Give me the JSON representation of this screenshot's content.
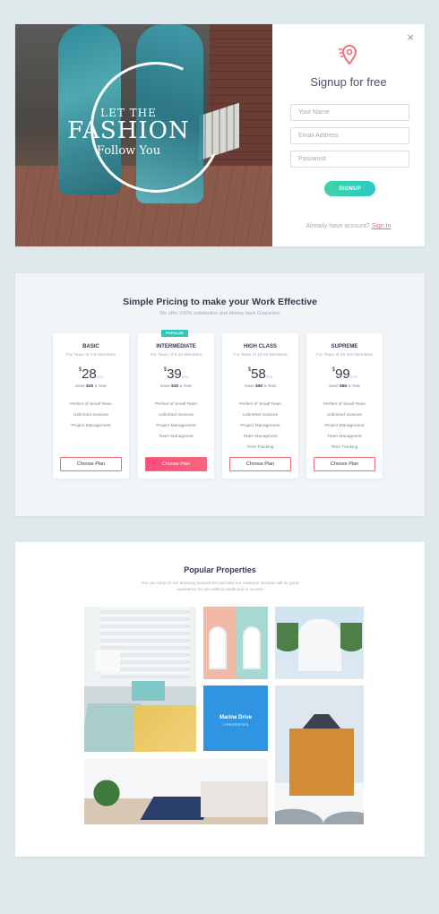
{
  "signup": {
    "hero": {
      "line1": "LET THE",
      "line2": "FASHION",
      "line3": "Follow You"
    },
    "title": "Signup for free",
    "name_placeholder": "Your Name",
    "email_placeholder": "Email Address",
    "password_placeholder": "Password",
    "button": "SIGNUP",
    "already_text": "Already have account?",
    "signin_link": "Sign In",
    "close": "×",
    "accent_color": "#f36b7a"
  },
  "pricing": {
    "title": "Simple Pricing to make your Work Effective",
    "subtitle": "We offer 100% satisfaction and Money back Guarantee",
    "popular_badge": "POPULAR",
    "plans": [
      {
        "name": "BASIC",
        "for": "For Team of 2-5 Members",
        "currency": "$",
        "price": "28",
        "per": "/mo",
        "save_prefix": "Save",
        "save": "$20",
        "save_suffix": "a Year",
        "features": [
          "Perfect of Small Team",
          "Unlimited Invoices",
          "Project Management"
        ],
        "button": "Choose Plan"
      },
      {
        "name": "INTERMEDIATE",
        "for": "For Team of 5-10 Members",
        "currency": "$",
        "price": "39",
        "per": "/mo",
        "save_prefix": "Save",
        "save": "$30",
        "save_suffix": "a Year",
        "features": [
          "Perfect of Small Team",
          "Unlimited Invoices",
          "Project Management",
          "Team Managment"
        ],
        "button": "Choose Plan"
      },
      {
        "name": "HIGH CLASS",
        "for": "For Team of 10-25 Members",
        "currency": "$",
        "price": "58",
        "per": "/mo",
        "save_prefix": "Save",
        "save": "$50",
        "save_suffix": "a Year",
        "features": [
          "Perfect of Small Team",
          "Unlimited Invoices",
          "Project Management",
          "Team Managment",
          "Time Tracking"
        ],
        "button": "Choose Plan"
      },
      {
        "name": "SUPREME",
        "for": "For Team of 25-100 Members",
        "currency": "$",
        "price": "99",
        "per": "/mo",
        "save_prefix": "Save",
        "save": "$80",
        "save_suffix": "a Year",
        "features": [
          "Perfect of Small Team",
          "Unlimited Invoices",
          "Project Management",
          "Team Managment",
          "Time Tracking"
        ],
        "button": "Choose Plan"
      }
    ]
  },
  "properties": {
    "title": "Popular Properties",
    "subtitle": "You can relay on our amazing features list and also our customer services will be great experience for you without doubt and in no-time",
    "featured": {
      "name": "Marine Drive",
      "count": "3 PROPERTIES"
    }
  }
}
